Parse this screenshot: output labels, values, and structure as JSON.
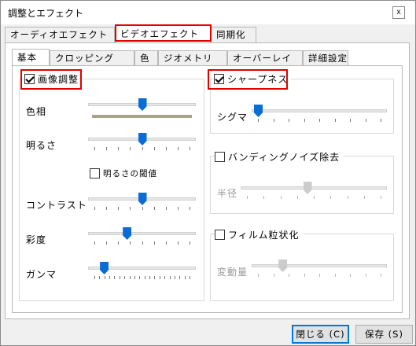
{
  "window": {
    "title": "調整とエフェクト",
    "close_glyph": "x"
  },
  "outer_tabs": [
    {
      "label": "オーディオエフェクト"
    },
    {
      "label": "ビデオエフェクト",
      "selected": true
    },
    {
      "label": "同期化"
    }
  ],
  "inner_tabs": [
    {
      "label": "基本",
      "selected": true
    },
    {
      "label": "クロッピング"
    },
    {
      "label": "色"
    },
    {
      "label": "ジオメトリ"
    },
    {
      "label": "オーバーレイ"
    },
    {
      "label": "詳細設定"
    }
  ],
  "image_adjust": {
    "label": "画像調整",
    "checked": true,
    "hue": {
      "label": "色相",
      "value": 0.5
    },
    "brightness": {
      "label": "明るさ",
      "value": 0.5
    },
    "brightness_threshold": {
      "label": "明るさの閾値",
      "checked": false
    },
    "contrast": {
      "label": "コントラスト",
      "value": 0.5
    },
    "saturation": {
      "label": "彩度",
      "value": 0.34
    },
    "gamma": {
      "label": "ガンマ",
      "value": 0.1
    }
  },
  "sharpen": {
    "label": "シャープネス",
    "checked": true,
    "sigma": {
      "label": "シグマ",
      "value": 0.0
    }
  },
  "banding": {
    "label": "バンディングノイズ除去",
    "checked": false,
    "radius": {
      "label": "半径",
      "value": 0.45
    }
  },
  "film_grain": {
    "label": "フィルム粒状化",
    "checked": false,
    "variance": {
      "label": "変動量",
      "value": 0.2
    }
  },
  "buttons": {
    "close": "閉じる (C)",
    "save": "保存 (S)"
  },
  "colors": {
    "accent": "#0a6dd6",
    "highlight": "#e00000",
    "disabled_thumb": "#cccccc"
  }
}
